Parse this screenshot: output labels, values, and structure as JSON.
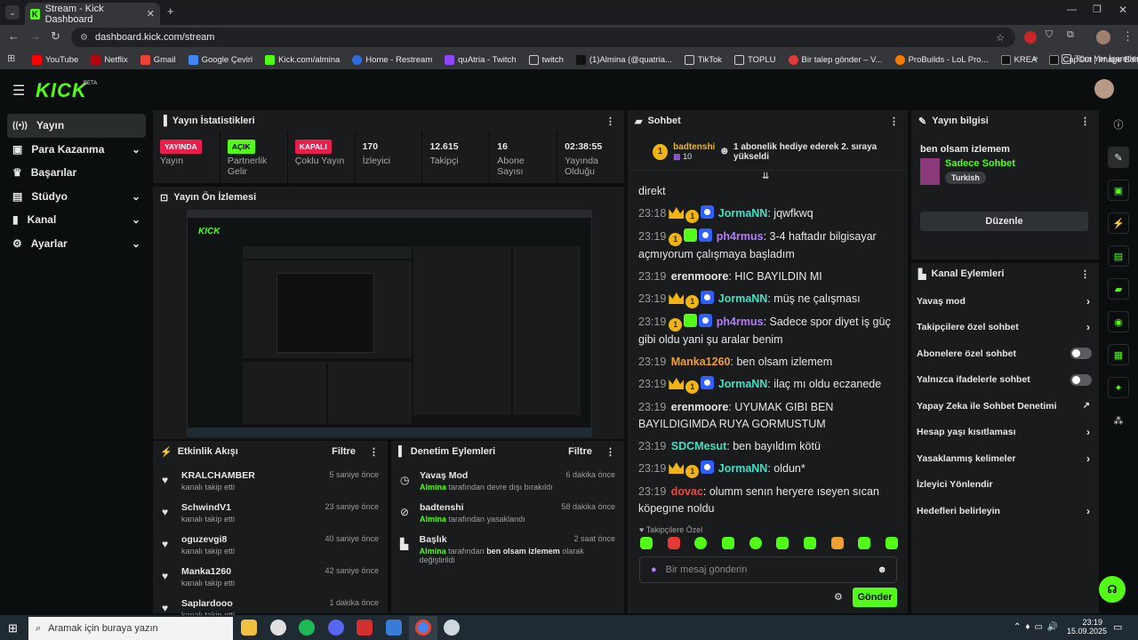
{
  "browser": {
    "tab_title": "Stream - Kick Dashboard",
    "url": "dashboard.kick.com/stream",
    "bookmarks": [
      "YouTube",
      "Netflix",
      "Gmail",
      "Google Çeviri",
      "Kick.com/almina",
      "Home - Restream",
      "quAtria - Twitch",
      "twitch",
      "(1)Almina (@quatria...",
      "TikTok",
      "TOPLU",
      "Bir talep gönder – V...",
      "ProBuilds - LoL Pro...",
      "KREA",
      "CapCut | Image Edit..."
    ],
    "all_bookmarks": "Tüm Yer İşaretleri"
  },
  "app": {
    "logo": "KICK",
    "beta": "BETA"
  },
  "nav": [
    {
      "label": "Yayın"
    },
    {
      "label": "Para Kazanma"
    },
    {
      "label": "Başarılar"
    },
    {
      "label": "Stüdyo"
    },
    {
      "label": "Kanal"
    },
    {
      "label": "Ayarlar"
    }
  ],
  "stats": {
    "title": "Yayın İstatistikleri",
    "items": [
      {
        "badge": "YAYINDA",
        "label": "Yayın",
        "color": "#e91e4d"
      },
      {
        "badge": "AÇIK",
        "label": "Partnerlik Gelir",
        "color": "#53fc18"
      },
      {
        "badge": "KAPALI",
        "label": "Çoklu Yayın",
        "color": "#e91e4d"
      },
      {
        "value": "170",
        "label": "İzleyici"
      },
      {
        "value": "12.615",
        "label": "Takipçi"
      },
      {
        "value": "16",
        "label": "Abone Sayısı"
      },
      {
        "value": "02:38:55",
        "label": "Yayında Olduğu"
      }
    ]
  },
  "preview": {
    "title": "Yayın Ön İzlemesi"
  },
  "feed": {
    "title": "Etkinlik Akışı",
    "filter": "Filtre",
    "items": [
      {
        "name": "KRALCHAMBER",
        "sub": "kanalı takip etti",
        "time": "5 saniye önce"
      },
      {
        "name": "SchwindV1",
        "sub": "kanalı takip etti",
        "time": "23 saniye önce"
      },
      {
        "name": "oguzevgi8",
        "sub": "kanalı takip etti",
        "time": "40 saniye önce"
      },
      {
        "name": "Manka1260",
        "sub": "kanalı takip etti",
        "time": "42 saniye önce"
      },
      {
        "name": "Saplardooo",
        "sub": "kanalı takip etti",
        "time": "1 dakika önce"
      }
    ]
  },
  "mod": {
    "title": "Denetim Eylemleri",
    "filter": "Filtre",
    "items": [
      {
        "name": "Yavaş Mod",
        "actor": "Almina",
        "text": "tarafından devre dışı bırakıldı",
        "extra": "",
        "tail": "",
        "time": "6 dakika önce"
      },
      {
        "name": "badtenshi",
        "actor": "Almina",
        "text": "tarafından yasaklandı",
        "extra": "",
        "tail": "",
        "time": "58 dakika önce"
      },
      {
        "name": "Başlık",
        "actor": "Almina",
        "text": "tarafından",
        "extra": "ben olsam izlemem",
        "tail": "olarak değiştirildi",
        "time": "2 saat önce"
      }
    ]
  },
  "chat": {
    "title": "Sohbet",
    "pinned_user": "badtenshi",
    "pinned_count": "10",
    "pinned_text": "1 abonelik hediye ederek 2. sıraya yükseldi",
    "partial_top": "direkt",
    "messages": [
      {
        "time": "23:18",
        "badges": [
          "crown",
          "one",
          "shield"
        ],
        "user": "JormaNN",
        "color": "#3fe0c0",
        "text": "jqwfkwq"
      },
      {
        "time": "23:19",
        "badges": [
          "one",
          "gift",
          "shield"
        ],
        "user": "ph4rmus",
        "color": "#b779ff",
        "text": "3-4 haftadır bilgisayar açmıyorum çalışmaya başladım"
      },
      {
        "time": "23:19",
        "badges": [],
        "user": "erenmoore",
        "color": "#e6e6e6",
        "text": "HIC BAYILDIN MI"
      },
      {
        "time": "23:19",
        "badges": [
          "crown",
          "one",
          "shield"
        ],
        "user": "JormaNN",
        "color": "#3fe0c0",
        "text": "müş ne çalışması"
      },
      {
        "time": "23:19",
        "badges": [
          "one",
          "gift",
          "shield"
        ],
        "user": "ph4rmus",
        "color": "#b779ff",
        "text": "Sadece spor diyet iş güç gibi oldu yani şu aralar benim"
      },
      {
        "time": "23:19",
        "badges": [],
        "user": "Manka1260",
        "color": "#f0a030",
        "text": "ben olsam izlemem"
      },
      {
        "time": "23:19",
        "badges": [
          "crown",
          "one",
          "shield"
        ],
        "user": "JormaNN",
        "color": "#3fe0c0",
        "text": "ilaç mı oldu eczanede"
      },
      {
        "time": "23:19",
        "badges": [],
        "user": "erenmoore",
        "color": "#e6e6e6",
        "text": "UYUMAK GIBI BEN BAYILDIGIMDA RUYA GORMUSTUM"
      },
      {
        "time": "23:19",
        "badges": [],
        "user": "SDCMesut",
        "color": "#3fe0c0",
        "text": "ben bayıldım kötü"
      },
      {
        "time": "23:19",
        "badges": [
          "crown",
          "one",
          "shield"
        ],
        "user": "JormaNN",
        "color": "#3fe0c0",
        "text": "oldun*"
      },
      {
        "time": "23:19",
        "badges": [],
        "user": "dovac",
        "color": "#e84a4a",
        "text": "olumm senın heryere ıseyen sıcan köpegıne noldu"
      }
    ],
    "followers_only": "Takipçilere Özel",
    "placeholder": "Bir mesaj gönderin",
    "send": "Gönder"
  },
  "info": {
    "title": "Yayın bilgisi",
    "stream_title": "ben olsam izlemem",
    "category": "Sadece Sohbet",
    "tag": "Turkish",
    "edit": "Düzenle"
  },
  "channel": {
    "title": "Kanal Eylemleri",
    "items": [
      {
        "label": "Yavaş mod",
        "ctrl": "arrow"
      },
      {
        "label": "Takipçilere özel sohbet",
        "ctrl": "arrow"
      },
      {
        "label": "Abonelere özel sohbet",
        "ctrl": "toggle"
      },
      {
        "label": "Yalnızca ifadelerle sohbet",
        "ctrl": "toggle"
      },
      {
        "label": "Yapay Zeka ile Sohbet Denetimi",
        "ctrl": "ext"
      },
      {
        "label": "Hesap yaşı kısıtlaması",
        "ctrl": "arrow"
      },
      {
        "label": "Yasaklanmış kelimeler",
        "ctrl": "arrow"
      },
      {
        "label": "İzleyici Yönlendir",
        "ctrl": "none"
      },
      {
        "label": "Hedefleri belirleyin",
        "ctrl": "arrow"
      }
    ]
  },
  "taskbar": {
    "search_placeholder": "Aramak için buraya yazın",
    "time": "23:19",
    "date": "15.09.2025"
  }
}
